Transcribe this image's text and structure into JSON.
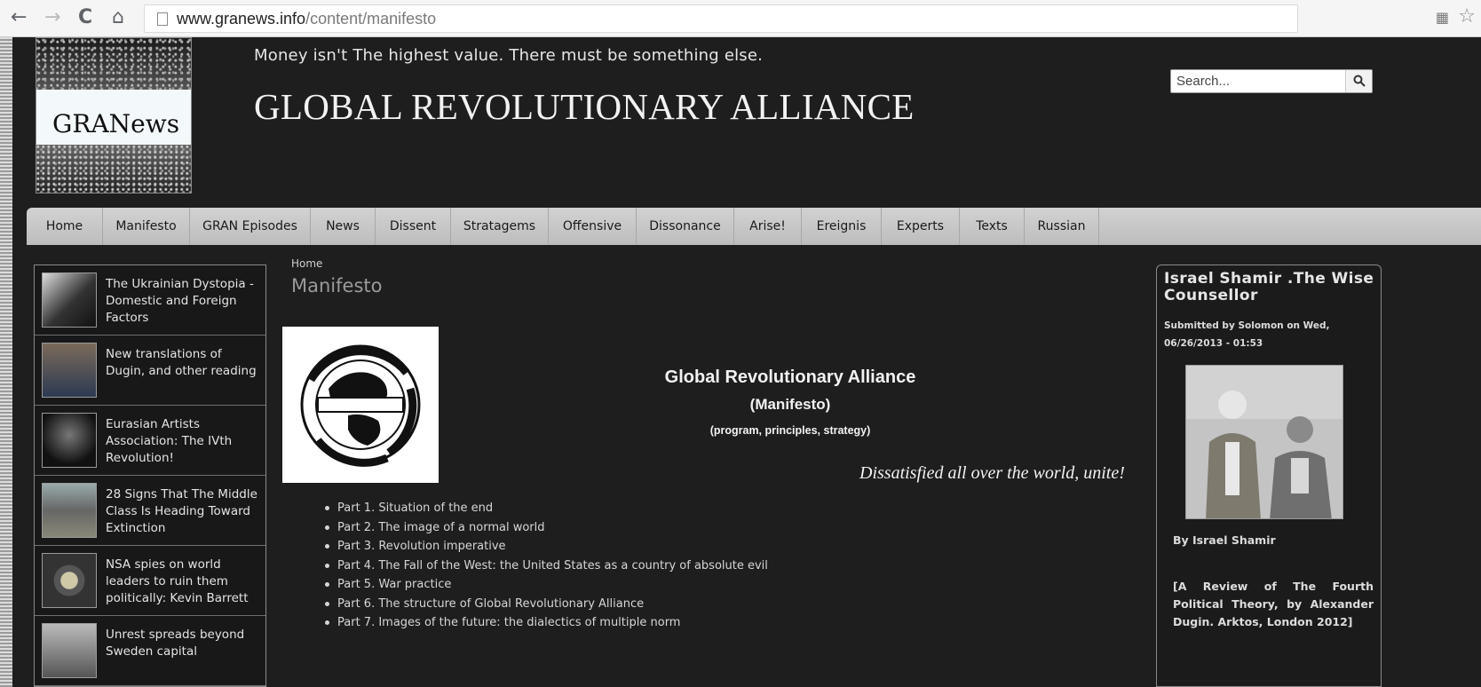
{
  "browser": {
    "url_domain": "www.granews.info",
    "url_path": "/content/manifesto"
  },
  "header": {
    "logo_text": "GRANews",
    "slogan": "Money isn't The highest value. There must be something else.",
    "site_title": "GLOBAL REVOLUTIONARY ALLIANCE",
    "search_placeholder": "Search..."
  },
  "menu": {
    "items": [
      {
        "label": "Home"
      },
      {
        "label": "Manifesto"
      },
      {
        "label": "GRAN Episodes"
      },
      {
        "label": "News"
      },
      {
        "label": "Dissent"
      },
      {
        "label": "Stratagems"
      },
      {
        "label": "Offensive"
      },
      {
        "label": "Dissonance"
      },
      {
        "label": "Arise!"
      },
      {
        "label": "Ereignis"
      },
      {
        "label": "Experts"
      },
      {
        "label": "Texts"
      },
      {
        "label": "Russian"
      }
    ]
  },
  "sidebar_left": {
    "posts": [
      {
        "title": "The Ukrainian Dystopia - Domestic and Foreign Factors"
      },
      {
        "title": "New translations of Dugin, and other reading"
      },
      {
        "title": "Eurasian Artists Association: The IVth Revolution!"
      },
      {
        "title": "28 Signs That The Middle Class Is Heading Toward Extinction"
      },
      {
        "title": "NSA spies on world leaders to ruin them politically: Kevin Barrett"
      },
      {
        "title": "Unrest spreads beyond Sweden capital"
      }
    ]
  },
  "main": {
    "breadcrumb": "Home",
    "page_title": "Manifesto",
    "doc_title": "Global Revolutionary Alliance",
    "doc_subtitle": "(Manifesto)",
    "doc_subtitle2": "(program, principles, strategy)",
    "motto": "Dissatisfied all over the world, unite!",
    "parts": [
      "Part 1. Situation of the end",
      "Part 2. The image of a normal world",
      "Part 3. Revolution imperative",
      "Part 4. The Fall of the West: the United States as a country of absolute evil",
      "Part 5. War practice",
      "Part 6. The structure of Global Revolutionary Alliance",
      "Part 7. Images of the future: the dialectics of multiple norm"
    ]
  },
  "sidebar_right": {
    "title": "Israel Shamir .The Wise Counsellor",
    "submitted": "Submitted by Solomon on Wed, 06/26/2013 - 01:53",
    "byline": "By Israel Shamir",
    "review": "[A Review of The Fourth Political Theory, by Alexander Dugin. Arktos, London 2012]"
  },
  "colors": {
    "page_bg": "#1e1e1e",
    "menu_bg": "#c8c8c8",
    "text": "#e8e8e8"
  }
}
